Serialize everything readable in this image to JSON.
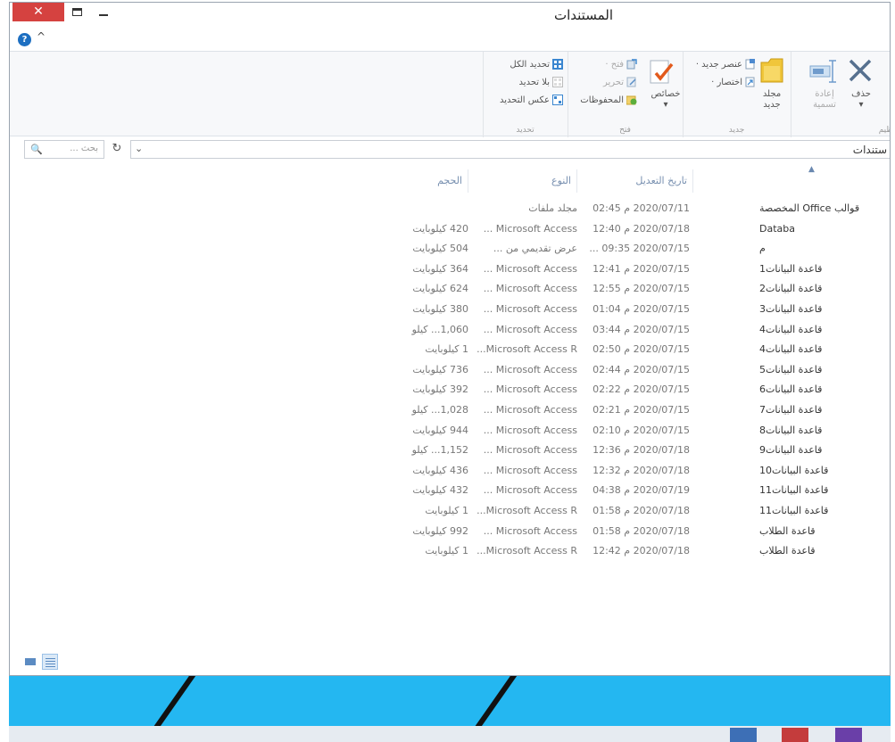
{
  "window": {
    "title": "المستندات",
    "close_glyph": "✕",
    "collapse_glyph": "^",
    "help_glyph": "?"
  },
  "ribbon": {
    "select_group": {
      "label": "تحديد",
      "select_all": "تحديد الكل",
      "select_none": "بلا تحديد",
      "invert_selection": "عكس التحديد"
    },
    "open_group": {
      "label": "فتح",
      "open": "فتح ·",
      "edit": "تحرير",
      "history": "المحفوظات",
      "properties": "خصائص"
    },
    "new_group": {
      "label": "جديد",
      "new_item": "عنصر جديد ·",
      "shortcut": "اختصار ·",
      "new_folder_line1": "مجلد",
      "new_folder_line2": "جديد"
    },
    "organize_group": {
      "label": "تنظيم",
      "rename_line1": "إعادة",
      "rename_line2": "تسمية",
      "delete": "حذف"
    }
  },
  "address": {
    "path": "ستندات",
    "search_placeholder": "بحث ...",
    "chevron": "⌄",
    "refresh_glyph": "↻",
    "search_glyph": "🔍"
  },
  "list": {
    "sort_glyph": "▲",
    "columns": {
      "date": "تاريخ التعديل",
      "type": "النوع",
      "size": "الحجم"
    },
    "rows": [
      {
        "name": "قوالب Office المخصصة",
        "date": "2020/07/11 م 02:45",
        "type": "مجلد ملفات",
        "size": ""
      },
      {
        "name": "Databa",
        "date": "2020/07/18 م 12:40",
        "type": "Microsoft Access ...",
        "size": "420 كيلوبايت"
      },
      {
        "name": "م",
        "date": "2020/07/15 09:35 ...",
        "type": "عرض تقديمي من ...",
        "size": "504 كيلوبايت"
      },
      {
        "name": "قاعدة البيانات1",
        "date": "2020/07/15 م 12:41",
        "type": "Microsoft Access ...",
        "size": "364 كيلوبايت"
      },
      {
        "name": "قاعدة البيانات2",
        "date": "2020/07/15 م 12:55",
        "type": "Microsoft Access ...",
        "size": "624 كيلوبايت"
      },
      {
        "name": "قاعدة البيانات3",
        "date": "2020/07/15 م 01:04",
        "type": "Microsoft Access ...",
        "size": "380 كيلوبايت"
      },
      {
        "name": "قاعدة البيانات4",
        "date": "2020/07/15 م 03:44",
        "type": "Microsoft Access ...",
        "size": "1,060... كيلو"
      },
      {
        "name": "قاعدة البيانات4",
        "date": "2020/07/15 م 02:50",
        "type": "Microsoft Access R...",
        "size": "1 كيلوبايت"
      },
      {
        "name": "قاعدة البيانات5",
        "date": "2020/07/15 م 02:44",
        "type": "Microsoft Access ...",
        "size": "736 كيلوبايت"
      },
      {
        "name": "قاعدة البيانات6",
        "date": "2020/07/15 م 02:22",
        "type": "Microsoft Access ...",
        "size": "392 كيلوبايت"
      },
      {
        "name": "قاعدة البيانات7",
        "date": "2020/07/15 م 02:21",
        "type": "Microsoft Access ...",
        "size": "1,028... كيلو"
      },
      {
        "name": "قاعدة البيانات8",
        "date": "2020/07/15 م 02:10",
        "type": "Microsoft Access ...",
        "size": "944 كيلوبايت"
      },
      {
        "name": "قاعدة البيانات9",
        "date": "2020/07/18 م 12:36",
        "type": "Microsoft Access ...",
        "size": "1,152... كيلو"
      },
      {
        "name": "قاعدة البيانات10",
        "date": "2020/07/18 م 12:32",
        "type": "Microsoft Access ...",
        "size": "436 كيلوبايت"
      },
      {
        "name": "قاعدة البيانات11",
        "date": "2020/07/19 م 04:38",
        "type": "Microsoft Access ...",
        "size": "432 كيلوبايت"
      },
      {
        "name": "قاعدة البيانات11",
        "date": "2020/07/18 م 01:58",
        "type": "Microsoft Access R...",
        "size": "1 كيلوبايت"
      },
      {
        "name": "قاعدة الطلاب",
        "date": "2020/07/18 م 01:58",
        "type": "Microsoft Access ...",
        "size": "992 كيلوبايت"
      },
      {
        "name": "قاعدة الطلاب",
        "date": "2020/07/18 م 12:42",
        "type": "Microsoft Access R...",
        "size": "1 كيلوبايت"
      }
    ]
  },
  "colors": {
    "close_button": "#d54240",
    "desktop": "#24b7f1",
    "accent": "#1d6fc1"
  }
}
